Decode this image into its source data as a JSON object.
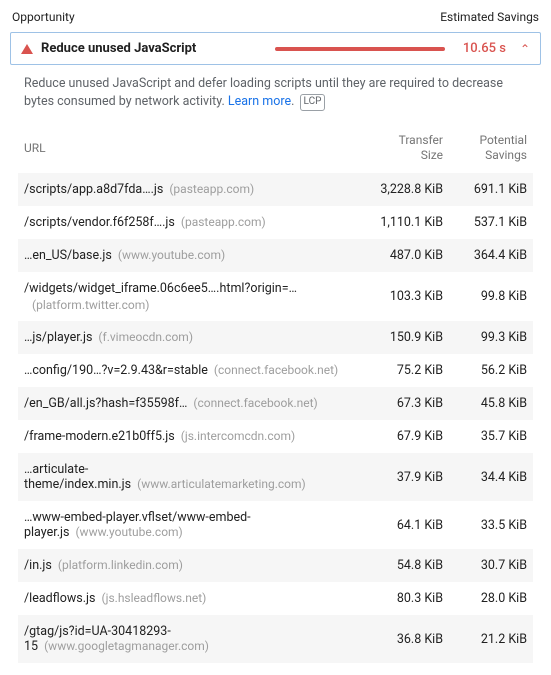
{
  "header": {
    "left": "Opportunity",
    "right": "Estimated Savings"
  },
  "audit": {
    "title": "Reduce unused JavaScript",
    "savings": "10.65 s"
  },
  "description": {
    "text": "Reduce unused JavaScript and defer loading scripts until they are required to decrease bytes consumed by network activity. ",
    "learn_more": "Learn more",
    "badge": "LCP"
  },
  "table": {
    "headers": {
      "url": "URL",
      "transfer_size_l1": "Transfer",
      "transfer_size_l2": "Size",
      "potential_l1": "Potential",
      "potential_l2": "Savings"
    },
    "rows": [
      {
        "path": "/scripts/app.a8d7fda….js",
        "origin": "(pasteapp.com)",
        "transfer": "3,228.8 KiB",
        "savings": "691.1 KiB",
        "stacked": false
      },
      {
        "path": "/scripts/vendor.f6f258f….js",
        "origin": "(pasteapp.com)",
        "transfer": "1,110.1 KiB",
        "savings": "537.1 KiB",
        "stacked": false
      },
      {
        "path": "…en_US/base.js",
        "origin": "(www.youtube.com)",
        "transfer": "487.0 KiB",
        "savings": "364.4 KiB",
        "stacked": false
      },
      {
        "path": "/widgets/widget_iframe.06c6ee5….html?origin=…",
        "origin": "(platform.twitter.com)",
        "transfer": "103.3 KiB",
        "savings": "99.8 KiB",
        "stacked": true
      },
      {
        "path": "…js/player.js",
        "origin": "(f.vimeocdn.com)",
        "transfer": "150.9 KiB",
        "savings": "99.3 KiB",
        "stacked": false
      },
      {
        "path": "…config/190…?v=2.9.43&r=stable",
        "origin": "(connect.facebook.net)",
        "transfer": "75.2 KiB",
        "savings": "56.2 KiB",
        "stacked": false
      },
      {
        "path": "/en_GB/all.js?hash=f35598f…",
        "origin": "(connect.facebook.net)",
        "transfer": "67.3 KiB",
        "savings": "45.8 KiB",
        "stacked": false
      },
      {
        "path": "/frame-modern.e21b0ff5.js",
        "origin": "(js.intercomcdn.com)",
        "transfer": "67.9 KiB",
        "savings": "35.7 KiB",
        "stacked": false
      },
      {
        "path": "…articulate-theme/index.min.js",
        "origin": "(www.articulatemarketing.com)",
        "transfer": "37.9 KiB",
        "savings": "34.4 KiB",
        "stacked": false
      },
      {
        "path": "…www-embed-player.vflset/www-embed-player.js",
        "origin": "(www.youtube.com)",
        "transfer": "64.1 KiB",
        "savings": "33.5 KiB",
        "stacked": false
      },
      {
        "path": "/in.js",
        "origin": "(platform.linkedin.com)",
        "transfer": "54.8 KiB",
        "savings": "30.7 KiB",
        "stacked": false
      },
      {
        "path": "/leadflows.js",
        "origin": "(js.hsleadflows.net)",
        "transfer": "80.3 KiB",
        "savings": "28.0 KiB",
        "stacked": false
      },
      {
        "path": "/gtag/js?id=UA-30418293-15",
        "origin": "(www.googletagmanager.com)",
        "transfer": "36.8 KiB",
        "savings": "21.2 KiB",
        "stacked": false
      }
    ]
  }
}
